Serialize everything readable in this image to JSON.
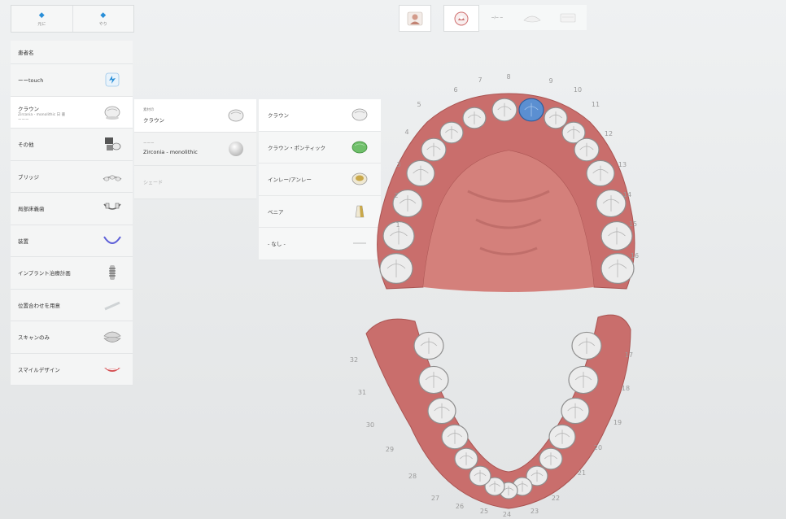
{
  "top_buttons": [
    {
      "icon": "undo-arrow-icon",
      "label": "元に"
    },
    {
      "icon": "redo-arrow-icon",
      "label": "やり"
    }
  ],
  "toolbar": [
    {
      "name": "patient-view-icon"
    },
    {
      "name": "restoration-view-icon",
      "selected": true
    },
    {
      "name": "tooth-view-icon",
      "label": "ー/ー ー"
    },
    {
      "name": "jaw-view-icon"
    },
    {
      "name": "scan-view-icon"
    }
  ],
  "panel": {
    "header": "患者名",
    "rows": [
      {
        "label": "ーーtouch",
        "icon": "touch-icon"
      },
      {
        "label": "クラウン",
        "sub1": "Zirconia - monolithic 日 書",
        "sub2": "ーーー",
        "icon": "crown-icon",
        "active": true
      },
      {
        "label": "その他",
        "icon": "other-icon"
      },
      {
        "label": "ブリッジ",
        "icon": "bridge-icon"
      },
      {
        "label": "局部床義歯",
        "icon": "partial-denture-icon"
      },
      {
        "label": "装置",
        "icon": "appliance-icon"
      },
      {
        "label": "インプラント治療計画",
        "icon": "implant-icon"
      },
      {
        "label": "位置合わせを用意",
        "icon": "alignment-icon"
      },
      {
        "label": "スキャンのみ",
        "icon": "scan-only-icon"
      },
      {
        "label": "スマイルデザイン",
        "icon": "smile-design-icon"
      }
    ]
  },
  "col2": {
    "rows": [
      {
        "small": "素材の",
        "main": "クラウン",
        "icon": "crown-icon",
        "selected": true
      },
      {
        "small": "ーーー",
        "main": "Zirconia - monolithic",
        "icon": "zirconia-sphere-icon"
      },
      {
        "mid": "シェード"
      }
    ]
  },
  "col3": {
    "rows": [
      {
        "label": "クラウン",
        "icon": "crown-icon",
        "selected": true
      },
      {
        "label": "クラウン・ポンティック",
        "icon": "pontic-icon"
      },
      {
        "label": "インレー/アンレー",
        "icon": "inlay-onlay-icon"
      },
      {
        "label": "ベニア",
        "icon": "veneer-icon"
      },
      {
        "label": "- なし -",
        "icon": "none-icon"
      }
    ]
  },
  "upper_teeth_numbers": [
    "1",
    "2",
    "3",
    "4",
    "5",
    "6",
    "7",
    "8",
    "9",
    "10",
    "11",
    "12",
    "13",
    "14",
    "15",
    "16"
  ],
  "lower_teeth_numbers": [
    "17",
    "18",
    "19",
    "20",
    "21",
    "22",
    "23",
    "24",
    "25",
    "26",
    "27",
    "28",
    "29",
    "30",
    "31",
    "32"
  ],
  "selected_tooth": "9",
  "colors": {
    "gum": "#c96e6c",
    "tooth": "#ececec",
    "selected_tooth": "#5b8fd1",
    "accent": "#2a8fd8"
  }
}
